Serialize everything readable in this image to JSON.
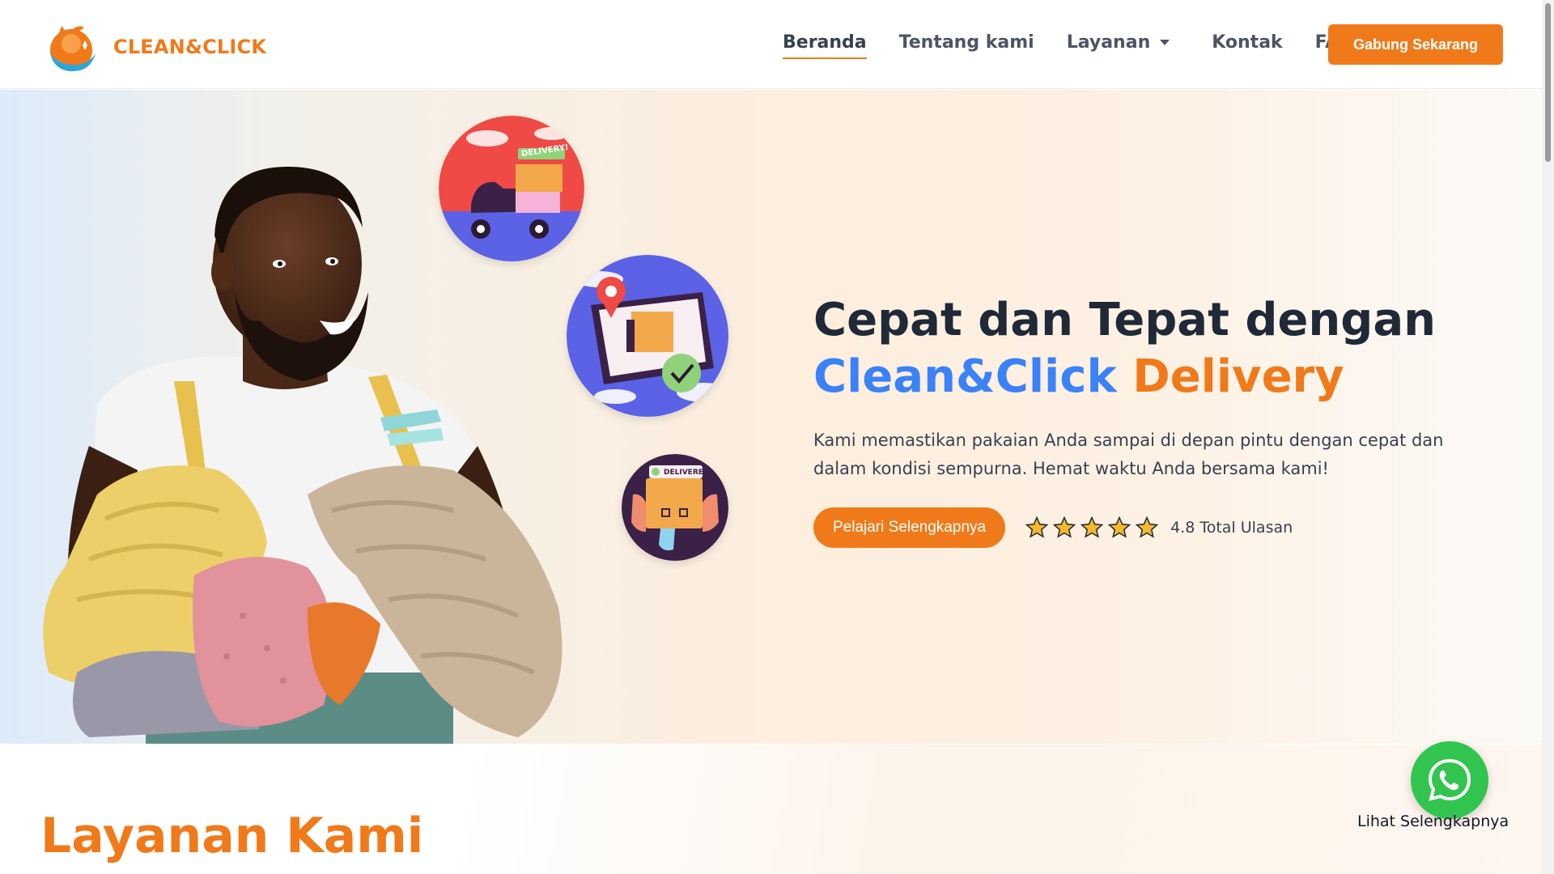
{
  "brand": {
    "name": "CLEAN&CLICK",
    "accent_color": "#f07a1a",
    "blue_color": "#3b82f6"
  },
  "nav": {
    "items": [
      {
        "label": "Beranda",
        "active": true
      },
      {
        "label": "Tentang kami",
        "active": false
      },
      {
        "label": "Layanan",
        "active": false,
        "has_dropdown": true
      },
      {
        "label": "Kontak",
        "active": false
      },
      {
        "label": "FAQ",
        "active": false
      }
    ],
    "cta_label": "Gabung Sekarang"
  },
  "hero": {
    "title_line1": "Cepat dan Tepat dengan",
    "title_brand": "Clean&Click",
    "title_highlight": "Delivery",
    "description": "Kami memastikan pakaian Anda sampai di depan pintu dengan cepat dan dalam kondisi sempurna. Hemat waktu Anda bersama kami!",
    "learn_more_label": "Pelajari Selengkapnya",
    "rating_stars": 5,
    "rating_text": "4.8 Total Ulasan",
    "badges": [
      {
        "icon": "delivery-scooter-icon",
        "text": "DELIVERY!"
      },
      {
        "icon": "location-tracking-icon",
        "text": ""
      },
      {
        "icon": "package-delivered-icon",
        "text": "DELIVERED"
      }
    ]
  },
  "services": {
    "title": "Layanan Kami"
  },
  "whatsapp": {
    "icon": "whatsapp-icon",
    "label": "Lihat Selengkapnya",
    "color": "#31c54f"
  }
}
